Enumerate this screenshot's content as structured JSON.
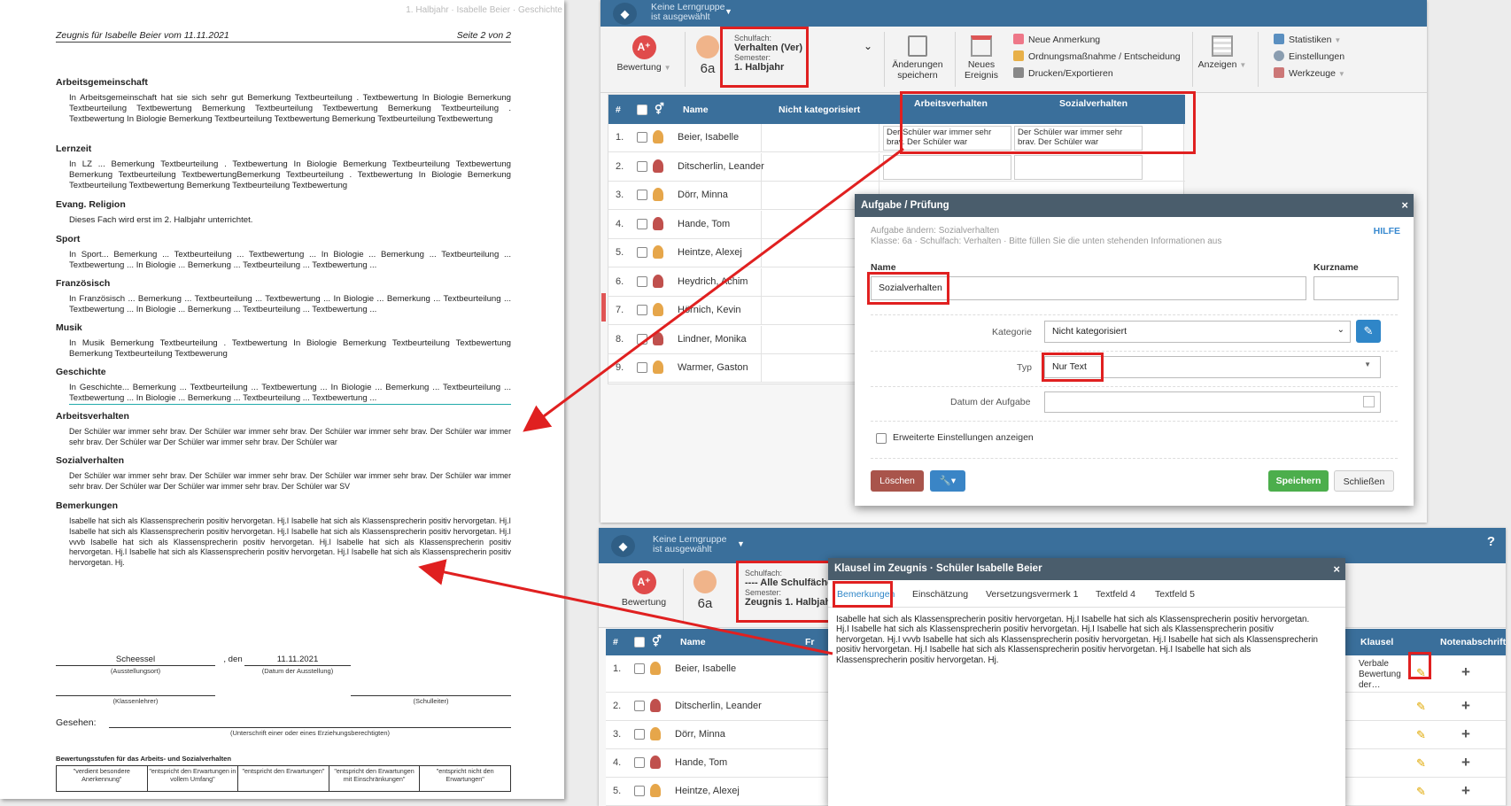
{
  "doc": {
    "running_header": "1. Halbjahr · Isabelle Beier · Geschichte",
    "title": "Zeugnis für Isabelle Beier vom 11.11.2021",
    "page": "Seite 2 von 2",
    "sections": [
      {
        "heading": "Arbeitsgemeinschaft",
        "text": "In Arbeitsgemeinschaft hat sie sich sehr gut Bemerkung Textbeurteilung . Textbewertung In Biologie Bemerkung Textbeurteilung Textbewertung Bemerkung Textbeurteilung Textbewertung Bemerkung Textbeurteilung . Textbewertung In Biologie Bemerkung Textbeurteilung Textbewertung Bemerkung Textbeurteilung Textbewertung"
      },
      {
        "heading": "Lernzeit",
        "text": "In LZ ... Bemerkung Textbeurteilung . Textbewertung In Biologie Bemerkung Textbeurteilung Textbewertung Bemerkung Textbeurteilung TextbewertungBemerkung Textbeurteilung . Textbewertung In Biologie Bemerkung Textbeurteilung Textbewertung Bemerkung Textbeurteilung Textbewertung"
      },
      {
        "heading": "Evang. Religion",
        "text": "Dieses Fach wird erst im 2. Halbjahr unterrichtet."
      },
      {
        "heading": "Sport",
        "text": "In Sport... Bemerkung ... Textbeurteilung ... Textbewertung ... In Biologie ... Bemerkung ... Textbeurteilung ... Textbewertung ... In Biologie ... Bemerkung ... Textbeurteilung ... Textbewertung ..."
      },
      {
        "heading": "Französisch",
        "text": "In Französisch ... Bemerkung ... Textbeurteilung ... Textbewertung ... In Biologie ... Bemerkung ... Textbeurteilung ... Textbewertung ... In Biologie ... Bemerkung ... Textbeurteilung ... Textbewertung ..."
      },
      {
        "heading": "Musik",
        "text": "In Musik Bemerkung Textbeurteilung . Textbewertung In Biologie Bemerkung Textbeurteilung Textbewertung Bemerkung Textbeurteilung Textbewerung"
      },
      {
        "heading": "Geschichte",
        "text": "In Geschichte... Bemerkung ... Textbeurteilung ... Textbewertung ... In Biologie ... Bemerkung ... Textbeurteilung ... Textbewertung ... In Biologie ... Bemerkung ... Textbeurteilung ... Textbewertung ..."
      },
      {
        "heading": "Arbeitsverhalten",
        "text": "Der Schüler war immer sehr brav. Der Schüler war immer sehr brav. Der Schüler war immer sehr brav. Der Schüler war immer sehr brav. Der Schüler war Der Schüler war immer sehr brav. Der Schüler war"
      },
      {
        "heading": "Sozialverhalten",
        "text": "Der Schüler war immer sehr brav. Der Schüler war immer sehr brav. Der Schüler war immer sehr brav. Der Schüler war immer sehr brav. Der Schüler war Der Schüler war immer sehr brav. Der Schüler war SV"
      },
      {
        "heading": "Bemerkungen",
        "text": "Isabelle hat sich als Klassensprecherin positiv hervorgetan. Hj.I Isabelle hat sich als Klassensprecherin positiv hervorgetan. Hj.I Isabelle hat sich als Klassensprecherin positiv hervorgetan. Hj.I Isabelle hat sich als Klassensprecherin positiv hervorgetan. Hj.I vvvb Isabelle hat sich als Klassensprecherin positiv hervorgetan. Hj.I Isabelle hat sich als Klassensprecherin positiv hervorgetan. Hj.I Isabelle hat sich als Klassensprecherin positiv hervorgetan. Hj.I Isabelle hat sich als Klassensprecherin positiv hervorgetan. Hj."
      }
    ],
    "place": "Scheessel",
    "place_label": "(Ausstellungsort)",
    "den": ", den",
    "date": "11.11.2021",
    "date_label": "(Datum der Ausstellung)",
    "teacher_label": "(Klassenlehrer)",
    "principal_label": "(Schulleiter)",
    "seen": "Gesehen:",
    "seen_label": "(Unterschrift einer oder eines Erziehungsberechtigten)",
    "legend_title": "Bewertungsstufen für das Arbeits- und Sozialverhalten",
    "legend": [
      "\"verdient besondere Anerkennung\"",
      "\"entspricht den Erwartungen in vollem Umfang\"",
      "\"entspricht den Erwartungen\"",
      "\"entspricht den Erwartungen mit Einschränkungen\"",
      "\"entspricht nicht den Erwartungen\""
    ]
  },
  "app1": {
    "group_line1": "Keine Lerngruppe",
    "group_line2": "ist ausgewählt",
    "bewertung": "Bewertung",
    "klasse": "6a",
    "schulfach_label": "Schulfach:",
    "schulfach": "Verhalten (Ver)",
    "semester_label": "Semester:",
    "semester": "1. Halbjahr",
    "aenderungen": "Änderungen speichern",
    "neues": "Neues Ereignis",
    "menu1": [
      "Neue Anmerkung",
      "Ordnungsmaßnahme / Entscheidung",
      "Drucken/Exportieren"
    ],
    "anzeigen": "Anzeigen",
    "menu2": [
      "Statistiken",
      "Einstellungen",
      "Werkzeuge"
    ],
    "col_hash": "#",
    "col_name": "Name",
    "col_nk": "Nicht kategorisiert",
    "col_av": "Arbeitsverhalten",
    "col_sv": "Sozialverhalten",
    "cell_text": "Der Schüler war immer sehr brav. Der Schüler war",
    "students": [
      "Beier, Isabelle",
      "Ditscherlin, Leander",
      "Dörr, Minna",
      "Hande, Tom",
      "Heintze, Alexej",
      "Heydrich, Achim",
      "Hörnich, Kevin",
      "Lindner, Monika",
      "Warmer, Gaston"
    ],
    "nums": [
      "1.",
      "2.",
      "3.",
      "4.",
      "5.",
      "6.",
      "7.",
      "8.",
      "9."
    ]
  },
  "dialog1": {
    "title": "Aufgabe / Prüfung",
    "close": "×",
    "subtitle": "Aufgabe ändern: Sozialverhalten",
    "info": "Klasse: 6a · Schulfach: Verhalten · Bitte füllen Sie die unten stehenden Informationen aus",
    "help": "HILFE",
    "name_label": "Name",
    "name_value": "Sozialverhalten",
    "kurz_label": "Kurzname",
    "kategorie_label": "Kategorie",
    "kategorie_value": "Nicht kategorisiert",
    "typ_label": "Typ",
    "typ_value": "Nur Text",
    "datum_label": "Datum der Aufgabe",
    "ext": "Erweiterte Einstellungen anzeigen",
    "delete": "Löschen",
    "save": "Speichern",
    "close_btn": "Schließen"
  },
  "app2": {
    "group_line1": "Keine Lerngruppe",
    "group_line2": "ist ausgewählt",
    "help": "?",
    "bewertung": "Bewertung",
    "klasse": "6a",
    "schulfach_label": "Schulfach:",
    "schulfach": "---- Alle Schulfächer",
    "semester_label": "Semester:",
    "semester": "Zeugnis 1. Halbjahr",
    "col_hash": "#",
    "col_name": "Name",
    "col_fr": "Fr",
    "col_klausel": "Klausel",
    "col_noten": "Notenabschrift",
    "students": [
      "Beier, Isabelle",
      "Ditscherlin, Leander",
      "Dörr, Minna",
      "Hande, Tom",
      "Heintze, Alexej"
    ],
    "nums": [
      "1.",
      "2.",
      "3.",
      "4.",
      "5."
    ],
    "klausel_cell": "Verbale Bewertung der…",
    "plus": "+"
  },
  "dialog2": {
    "title": "Klausel im Zeugnis · Schüler Isabelle Beier",
    "close": "×",
    "tabs": [
      "Bemerkungen",
      "Einschätzung",
      "Versetzungsvermerk 1",
      "Textfeld 4",
      "Textfeld 5"
    ],
    "text": "Isabelle hat sich als Klassensprecherin positiv hervorgetan. Hj.I Isabelle hat sich als Klassensprecherin positiv hervorgetan. Hj.I Isabelle hat sich als Klassensprecherin positiv hervorgetan. Hj.I Isabelle hat sich als Klassensprecherin positiv hervorgetan. Hj.I    vvvb Isabelle hat sich als Klassensprecherin positiv hervorgetan. Hj.I Isabelle hat sich als Klassensprecherin positiv hervorgetan. Hj.I Isabelle hat sich als Klassensprecherin positiv hervorgetan. Hj.I Isabelle hat sich als Klassensprecherin positiv hervorgetan. Hj."
  },
  "colors": {
    "accent": "#3a6f9b",
    "annotation": "#e02020",
    "save": "#4cae4c",
    "delete": "#a9544b"
  }
}
